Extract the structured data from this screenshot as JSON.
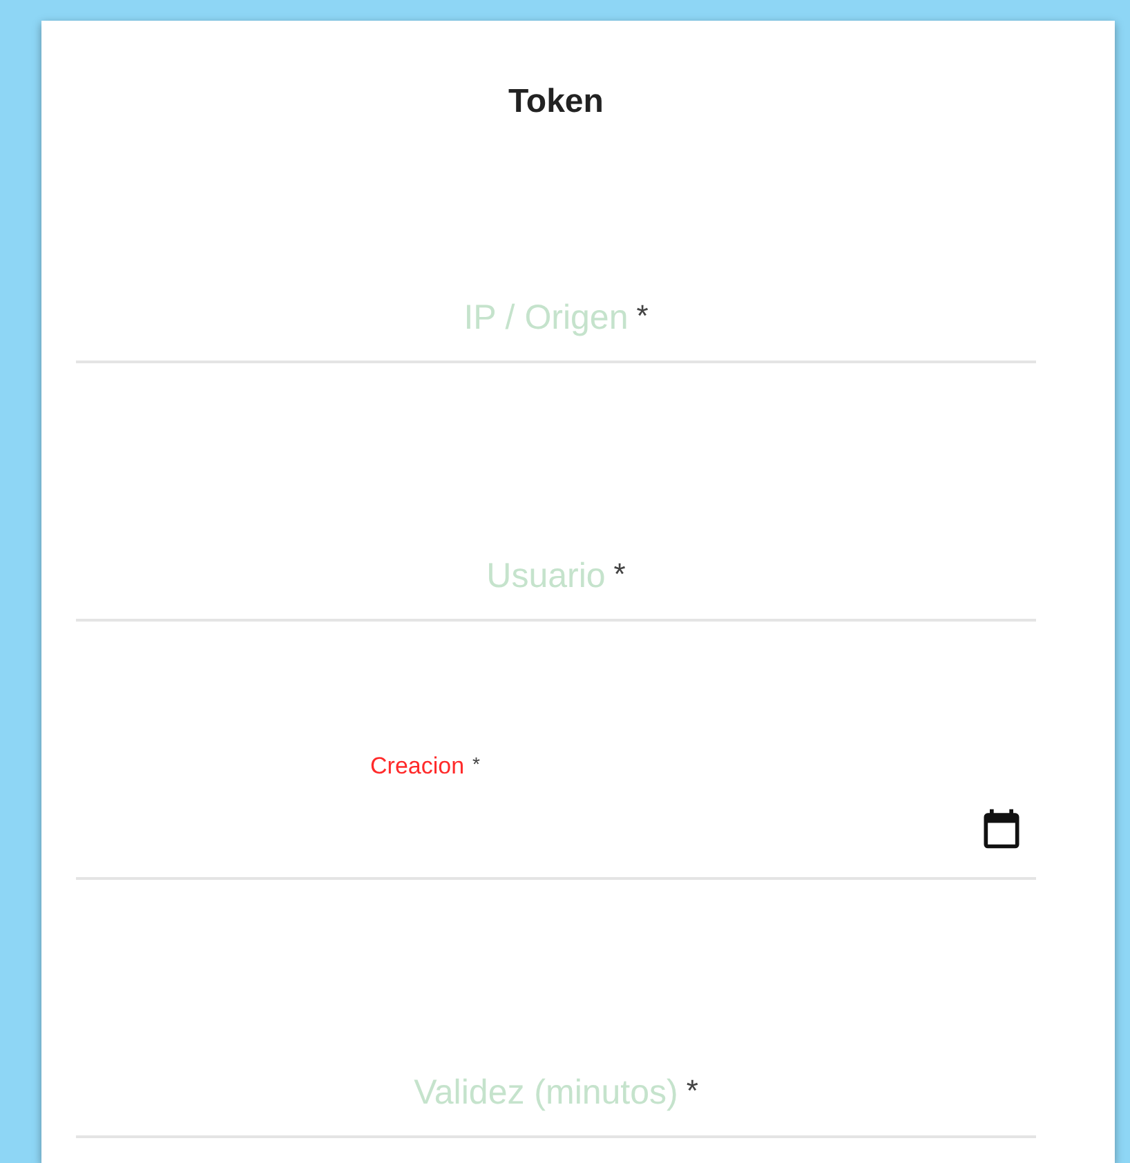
{
  "dialog": {
    "title": "Token"
  },
  "fields": [
    {
      "kind": "text",
      "label": "IP / Origen",
      "required_mark": "*",
      "invalid": false
    },
    {
      "kind": "text",
      "label": "Usuario",
      "required_mark": "*",
      "invalid": false
    },
    {
      "kind": "date",
      "label": "Creacion",
      "required_mark": "*",
      "invalid": true
    },
    {
      "kind": "text",
      "label": "Validez (minutos)",
      "required_mark": "*",
      "invalid": false
    }
  ]
}
